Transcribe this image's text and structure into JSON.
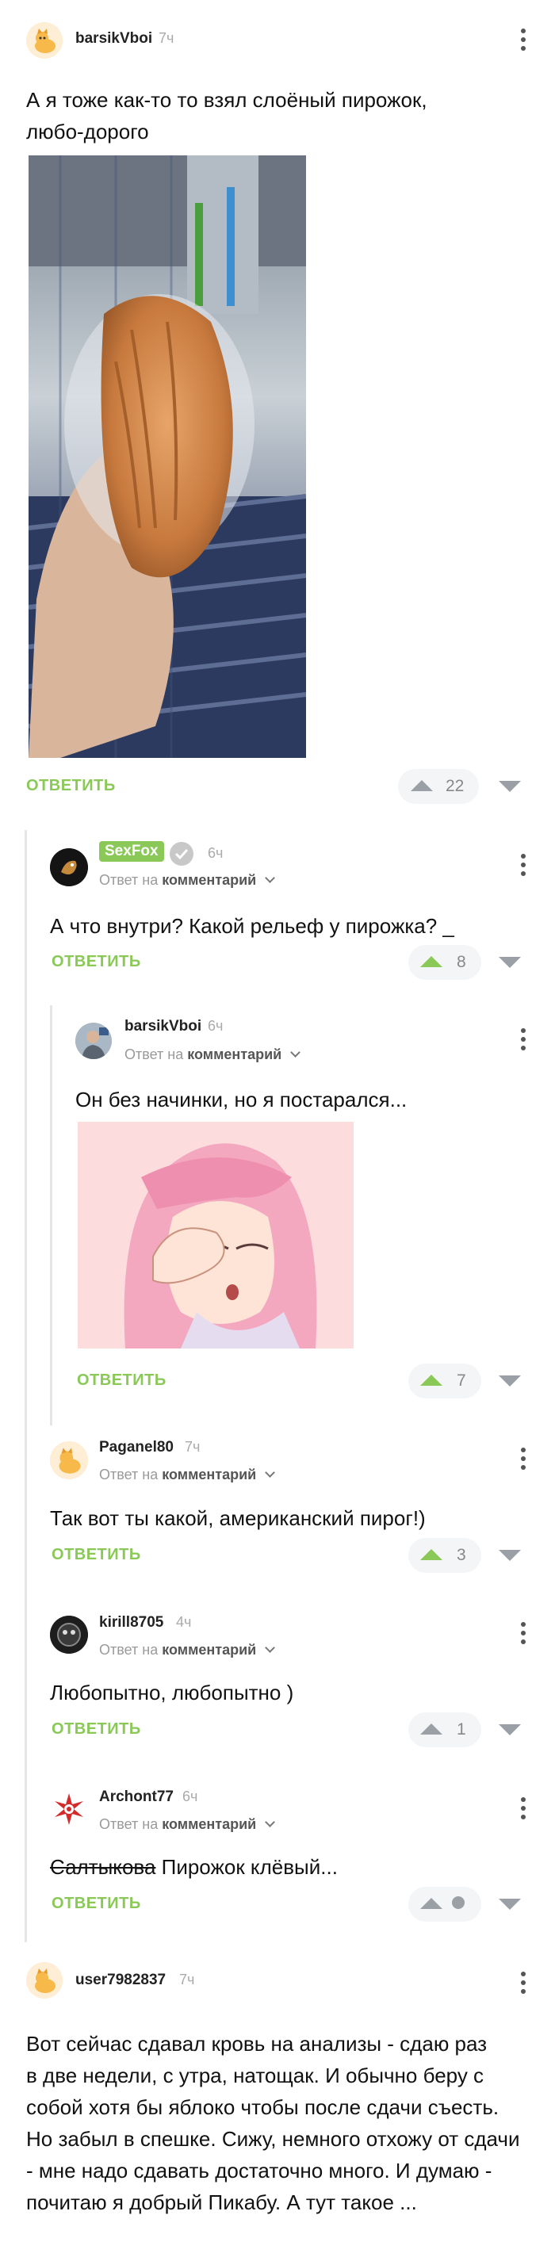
{
  "posts": {
    "barsik_main": {
      "username": "barsikVboi",
      "time": "7ч",
      "text_line1": "А я тоже как-то то взял слоёный пирожок,",
      "text_line2": "любо-дорого",
      "reply_label": "ОТВЕТИТЬ",
      "votes": "22"
    },
    "sexfox": {
      "username": "SexFox",
      "time": "6ч",
      "reply_prefix": "Ответ на",
      "reply_target": "комментарий",
      "text": "А что внутри? Какой рельеф у пирожка? _",
      "reply_label": "ОТВЕТИТЬ",
      "votes": "8"
    },
    "barsik_reply": {
      "username": "barsikVboi",
      "time": "6ч",
      "reply_prefix": "Ответ на",
      "reply_target": "комментарий",
      "text": "Он без начинки, но я постарался...",
      "reply_label": "ОТВЕТИТЬ",
      "votes": "7"
    },
    "paganel": {
      "username": "Paganel80",
      "time": "7ч",
      "reply_prefix": "Ответ на",
      "reply_target": "комментарий",
      "text": "Так вот ты какой, американский пирог!)",
      "reply_label": "ОТВЕТИТЬ",
      "votes": "3"
    },
    "kirill": {
      "username": "kirill8705",
      "time": "4ч",
      "reply_prefix": "Ответ на",
      "reply_target": "комментарий",
      "text": "Любопытно, любопытно )",
      "reply_label": "ОТВЕТИТЬ",
      "votes": "1"
    },
    "archont": {
      "username": "Archont77",
      "time": "6ч",
      "reply_prefix": "Ответ на",
      "reply_target": "комментарий",
      "text_struck": "Салтыкова",
      "text_rest": " Пирожок клёвый...",
      "reply_label": "ОТВЕТИТЬ"
    },
    "user798": {
      "username": "user7982837",
      "time": "7ч",
      "lines": [
        "Вот сейчас сдавал кровь на анализы - сдаю раз",
        "в две недели, с утра, натощак. И обычно беру с",
        "собой хотя бы яблоко чтобы после сдачи съесть.",
        "Но забыл в спешке. Сижу, немного отхожу от сдачи",
        "- мне надо сдавать достаточно много. И думаю -",
        "почитаю я добрый Пикабу. А тут такое ..."
      ]
    }
  },
  "colors": {
    "accent_green": "#8ac858",
    "thread_line": "#e4e6e8",
    "vote_pill": "#f3f5f7"
  },
  "icons": [
    "kebab-menu-icon",
    "upvote-icon",
    "downvote-icon",
    "chevron-down-icon",
    "verified-badge-icon"
  ]
}
